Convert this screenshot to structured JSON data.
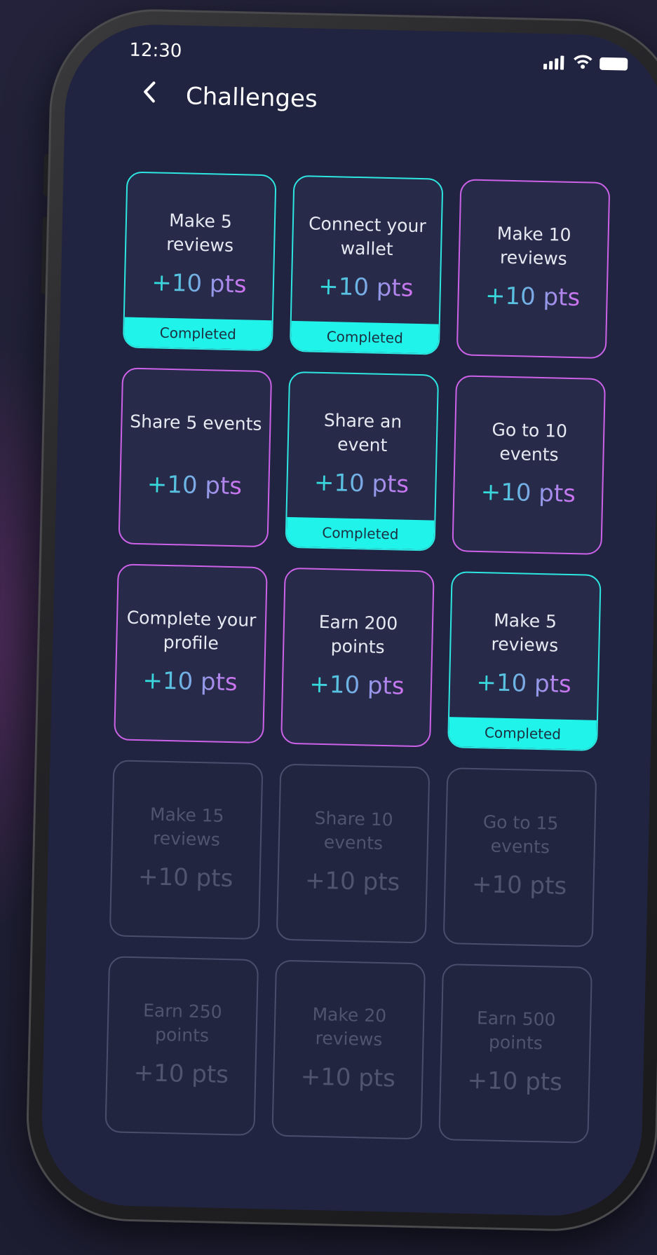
{
  "status_bar": {
    "time": "12:30"
  },
  "header": {
    "title": "Challenges"
  },
  "challenges": [
    {
      "label": "Make 5 reviews",
      "points": "+10 pts",
      "state": "completed",
      "status": "Completed"
    },
    {
      "label": "Connect your wallet",
      "points": "+10 pts",
      "state": "completed",
      "status": "Completed"
    },
    {
      "label": "Make 10 reviews",
      "points": "+10 pts",
      "state": "available"
    },
    {
      "label": "Share 5 events",
      "points": "+10 pts",
      "state": "available"
    },
    {
      "label": "Share an event",
      "points": "+10 pts",
      "state": "completed",
      "status": "Completed"
    },
    {
      "label": "Go to 10 events",
      "points": "+10 pts",
      "state": "available"
    },
    {
      "label": "Complete your profile",
      "points": "+10 pts",
      "state": "available"
    },
    {
      "label": "Earn 200 points",
      "points": "+10 pts",
      "state": "available"
    },
    {
      "label": "Make 5 reviews",
      "points": "+10 pts",
      "state": "completed",
      "status": "Completed"
    },
    {
      "label": "Make 15 reviews",
      "points": "+10 pts",
      "state": "locked"
    },
    {
      "label": "Share 10 events",
      "points": "+10 pts",
      "state": "locked"
    },
    {
      "label": "Go to 15 events",
      "points": "+10 pts",
      "state": "locked"
    },
    {
      "label": "Earn 250 points",
      "points": "+10 pts",
      "state": "locked"
    },
    {
      "label": "Make 20 reviews",
      "points": "+10 pts",
      "state": "locked"
    },
    {
      "label": "Earn 500 points",
      "points": "+10 pts",
      "state": "locked"
    }
  ],
  "colors": {
    "background": "#212440",
    "card": "#272a48",
    "teal": "#2ee6e1",
    "purple": "#cb62e8",
    "completed_bar": "#20f3ea",
    "locked": "#50546f"
  },
  "icons": [
    "back-chevron-icon",
    "signal-icon",
    "wifi-icon",
    "battery-icon"
  ]
}
